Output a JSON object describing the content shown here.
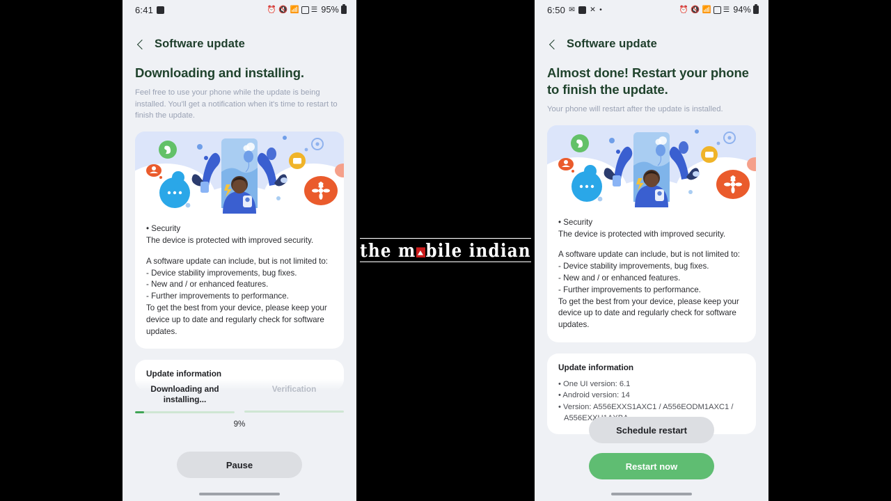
{
  "meta": {
    "watermark": "the m bile indian",
    "watermark_parts": {
      "pre": "the m",
      "post": "bile indian"
    }
  },
  "colors": {
    "screen_bg": "#eff1f5",
    "card_bg": "#ffffff",
    "heading_green": "#20432d",
    "accent_green": "#5fbd72",
    "progress_fill": "#3fa455",
    "progress_track": "#cfe6d3",
    "muted_text": "#9aa2b4",
    "grey_button": "#dcdee2"
  },
  "left_phone": {
    "status_bar": {
      "time": "6:41",
      "left_icons": [
        "music-note-icon"
      ],
      "right_icons": [
        "alarm-icon",
        "mute-icon",
        "wifi-icon",
        "volte-icon",
        "signal-icon"
      ],
      "battery_percent": "95%"
    },
    "header": {
      "back_icon": "back-chevron-icon",
      "title": "Software update"
    },
    "hero": {
      "title": "Downloading and installing.",
      "subtitle": "Feel free to use your phone while the update is being installed. You'll get a notification when it's time to restart to finish the update."
    },
    "illustration": {
      "name": "software-update-illustration"
    },
    "release_notes": {
      "lines": [
        "• Security",
        "The device is protected with improved security.",
        "",
        "A software update can include, but is not limited to:",
        " - Device stability improvements, bug fixes.",
        " - New and / or enhanced features.",
        " - Further improvements to performance.",
        "To get the best from your device, please keep your device up to date and regularly check for software updates."
      ]
    },
    "update_information": {
      "heading": "Update information",
      "items": []
    },
    "progress": {
      "step1_label": "Downloading and installing...",
      "step1_percent": 9,
      "percent_text": "9%",
      "step2_label": "Verification",
      "step2_percent": 0
    },
    "actions": {
      "pause_label": "Pause"
    },
    "gesture_bar": "gesture-bar"
  },
  "right_phone": {
    "status_bar": {
      "time": "6:50",
      "left_icons": [
        "whatsapp-icon",
        "checkbox-icon",
        "x-icon",
        "dot-icon"
      ],
      "right_icons": [
        "alarm-icon",
        "mute-icon",
        "wifi-icon",
        "volte-icon",
        "signal-icon"
      ],
      "battery_percent": "94%"
    },
    "header": {
      "back_icon": "back-chevron-icon",
      "title": "Software update"
    },
    "hero": {
      "title": "Almost done! Restart your phone to finish the update.",
      "subtitle": "Your phone will restart after the update is installed."
    },
    "illustration": {
      "name": "software-update-illustration"
    },
    "release_notes": {
      "lines": [
        "• Security",
        "The device is protected with improved security.",
        "",
        "A software update can include, but is not limited to:",
        " - Device stability improvements, bug fixes.",
        " - New and / or enhanced features.",
        " - Further improvements to performance.",
        "To get the best from your device, please keep your device up to date and regularly check for software updates."
      ]
    },
    "update_information": {
      "heading": "Update information",
      "items": [
        "• One UI version: 6.1",
        "• Android version: 14",
        "• Version: A556EXXS1AXC1 / A556EODM1AXC1 /",
        "A556EXXU1AXBA"
      ]
    },
    "actions": {
      "schedule_label": "Schedule restart",
      "restart_label": "Restart now"
    },
    "gesture_bar": "gesture-bar"
  }
}
